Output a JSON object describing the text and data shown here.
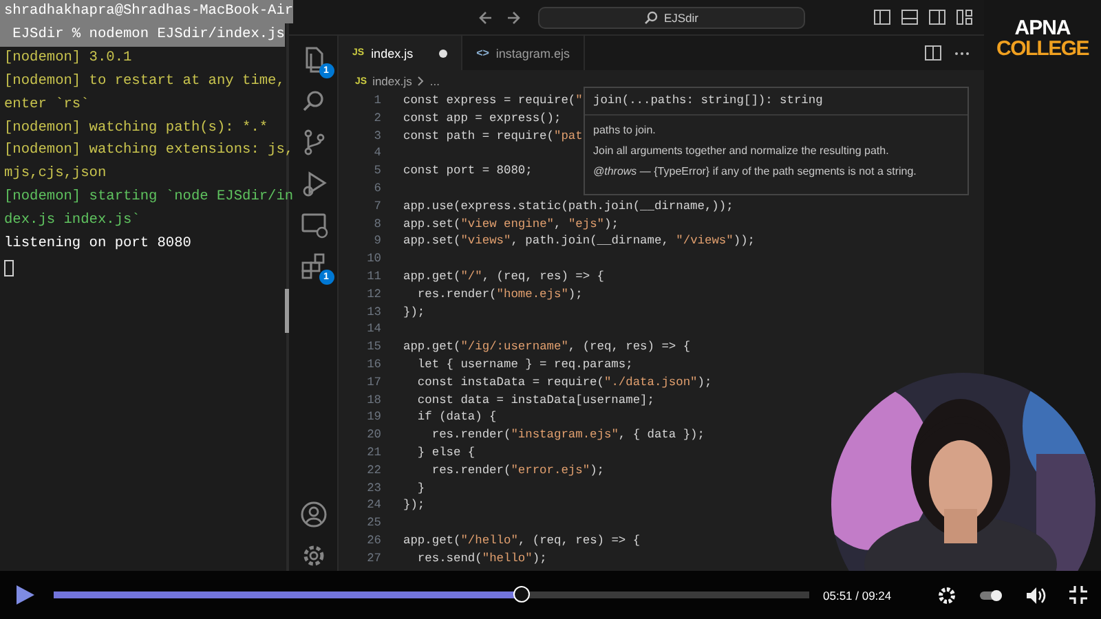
{
  "terminal": {
    "lines": [
      {
        "text": "shradhakhapra@Shradhas-MacBook-Air",
        "selected": true,
        "color": "#ffffff"
      },
      {
        "text": " EJSdir % nodemon EJSdir/index.js",
        "selected": true,
        "color": "#ffffff"
      },
      {
        "text": "[nodemon] 3.0.1",
        "selected": false,
        "color": "#c9c44e"
      },
      {
        "text": "[nodemon] to restart at any time,",
        "selected": false,
        "color": "#c9c44e"
      },
      {
        "text": "enter `rs`",
        "selected": false,
        "color": "#c9c44e"
      },
      {
        "text": "[nodemon] watching path(s): *.*",
        "selected": false,
        "color": "#c9c44e"
      },
      {
        "text": "[nodemon] watching extensions: js,",
        "selected": false,
        "color": "#c9c44e"
      },
      {
        "text": "mjs,cjs,json",
        "selected": false,
        "color": "#c9c44e"
      },
      {
        "text": "[nodemon] starting `node EJSdir/in",
        "selected": false,
        "color": "#5fc35f"
      },
      {
        "text": "dex.js index.js`",
        "selected": false,
        "color": "#5fc35f"
      },
      {
        "text": "listening on port 8080",
        "selected": false,
        "color": "#ffffff"
      }
    ]
  },
  "editor": {
    "search": "EJSdir",
    "activity_top": [
      {
        "kind": "files",
        "badge": "1"
      },
      {
        "kind": "search"
      },
      {
        "kind": "source-control"
      },
      {
        "kind": "run-debug"
      },
      {
        "kind": "remote"
      },
      {
        "kind": "extensions",
        "badge": "1"
      }
    ],
    "activity_bottom": [
      {
        "kind": "account"
      },
      {
        "kind": "settings"
      }
    ],
    "tabs": [
      {
        "label": "index.js",
        "kind": "js",
        "icon": "JS",
        "selected": true,
        "modified": true
      },
      {
        "label": "instagram.ejs",
        "kind": "ejs",
        "icon": "<>",
        "selected": false,
        "modified": false
      }
    ],
    "breadcrumb": [
      {
        "label": "index.js",
        "kind": "js",
        "icon": "JS"
      },
      {
        "label": "...",
        "kind": "more"
      }
    ],
    "code": [
      {
        "n": "1",
        "text": "const express = require(\""
      },
      {
        "n": "2",
        "text": "const app = express();"
      },
      {
        "n": "3",
        "text": "const path = require(\"pat"
      },
      {
        "n": "4"
      },
      {
        "n": "5",
        "text": "const port = 8080;"
      },
      {
        "n": "6"
      },
      {
        "n": "7",
        "text": "app.use(express.static(path.join(__dirname,));"
      },
      {
        "n": "8",
        "text": "app.set(\"view engine\", \"ejs\");"
      },
      {
        "n": "9",
        "text": "app.set(\"views\", path.join(__dirname, \"/views\"));"
      },
      {
        "n": "10"
      },
      {
        "n": "11",
        "text": "app.get(\"/\", (req, res) => {"
      },
      {
        "n": "12",
        "text": "  res.render(\"home.ejs\");"
      },
      {
        "n": "13",
        "text": "});"
      },
      {
        "n": "14"
      },
      {
        "n": "15",
        "text": "app.get(\"/ig/:username\", (req, res) => {"
      },
      {
        "n": "16",
        "text": "  let { username } = req.params;"
      },
      {
        "n": "17",
        "text": "  const instaData = require(\"./data.json\");"
      },
      {
        "n": "18",
        "text": "  const data = instaData[username];"
      },
      {
        "n": "19",
        "text": "  if (data) {"
      },
      {
        "n": "20",
        "text": "    res.render(\"instagram.ejs\", { data });"
      },
      {
        "n": "21",
        "text": "  } else {"
      },
      {
        "n": "22",
        "text": "    res.render(\"error.ejs\");"
      },
      {
        "n": "23",
        "text": "  }"
      },
      {
        "n": "24",
        "text": "});"
      },
      {
        "n": "25"
      },
      {
        "n": "26",
        "text": "app.get(\"/hello\", (req, res) => {"
      },
      {
        "n": "27",
        "text": "  res.send(\"hello\");"
      }
    ],
    "hover": {
      "signature": "join(...paths: string[]): string",
      "param": "paths to join.",
      "description": "Join all arguments together and normalize the resulting path.",
      "throws": "*@throws* — {TypeError} if any of the path segments is not a string."
    }
  },
  "brand": {
    "line1": "APNA",
    "line2": "COLLEGE"
  },
  "player": {
    "playing": false,
    "level": 0.62,
    "time": "05:51 / 09:24",
    "autoplay": true
  }
}
